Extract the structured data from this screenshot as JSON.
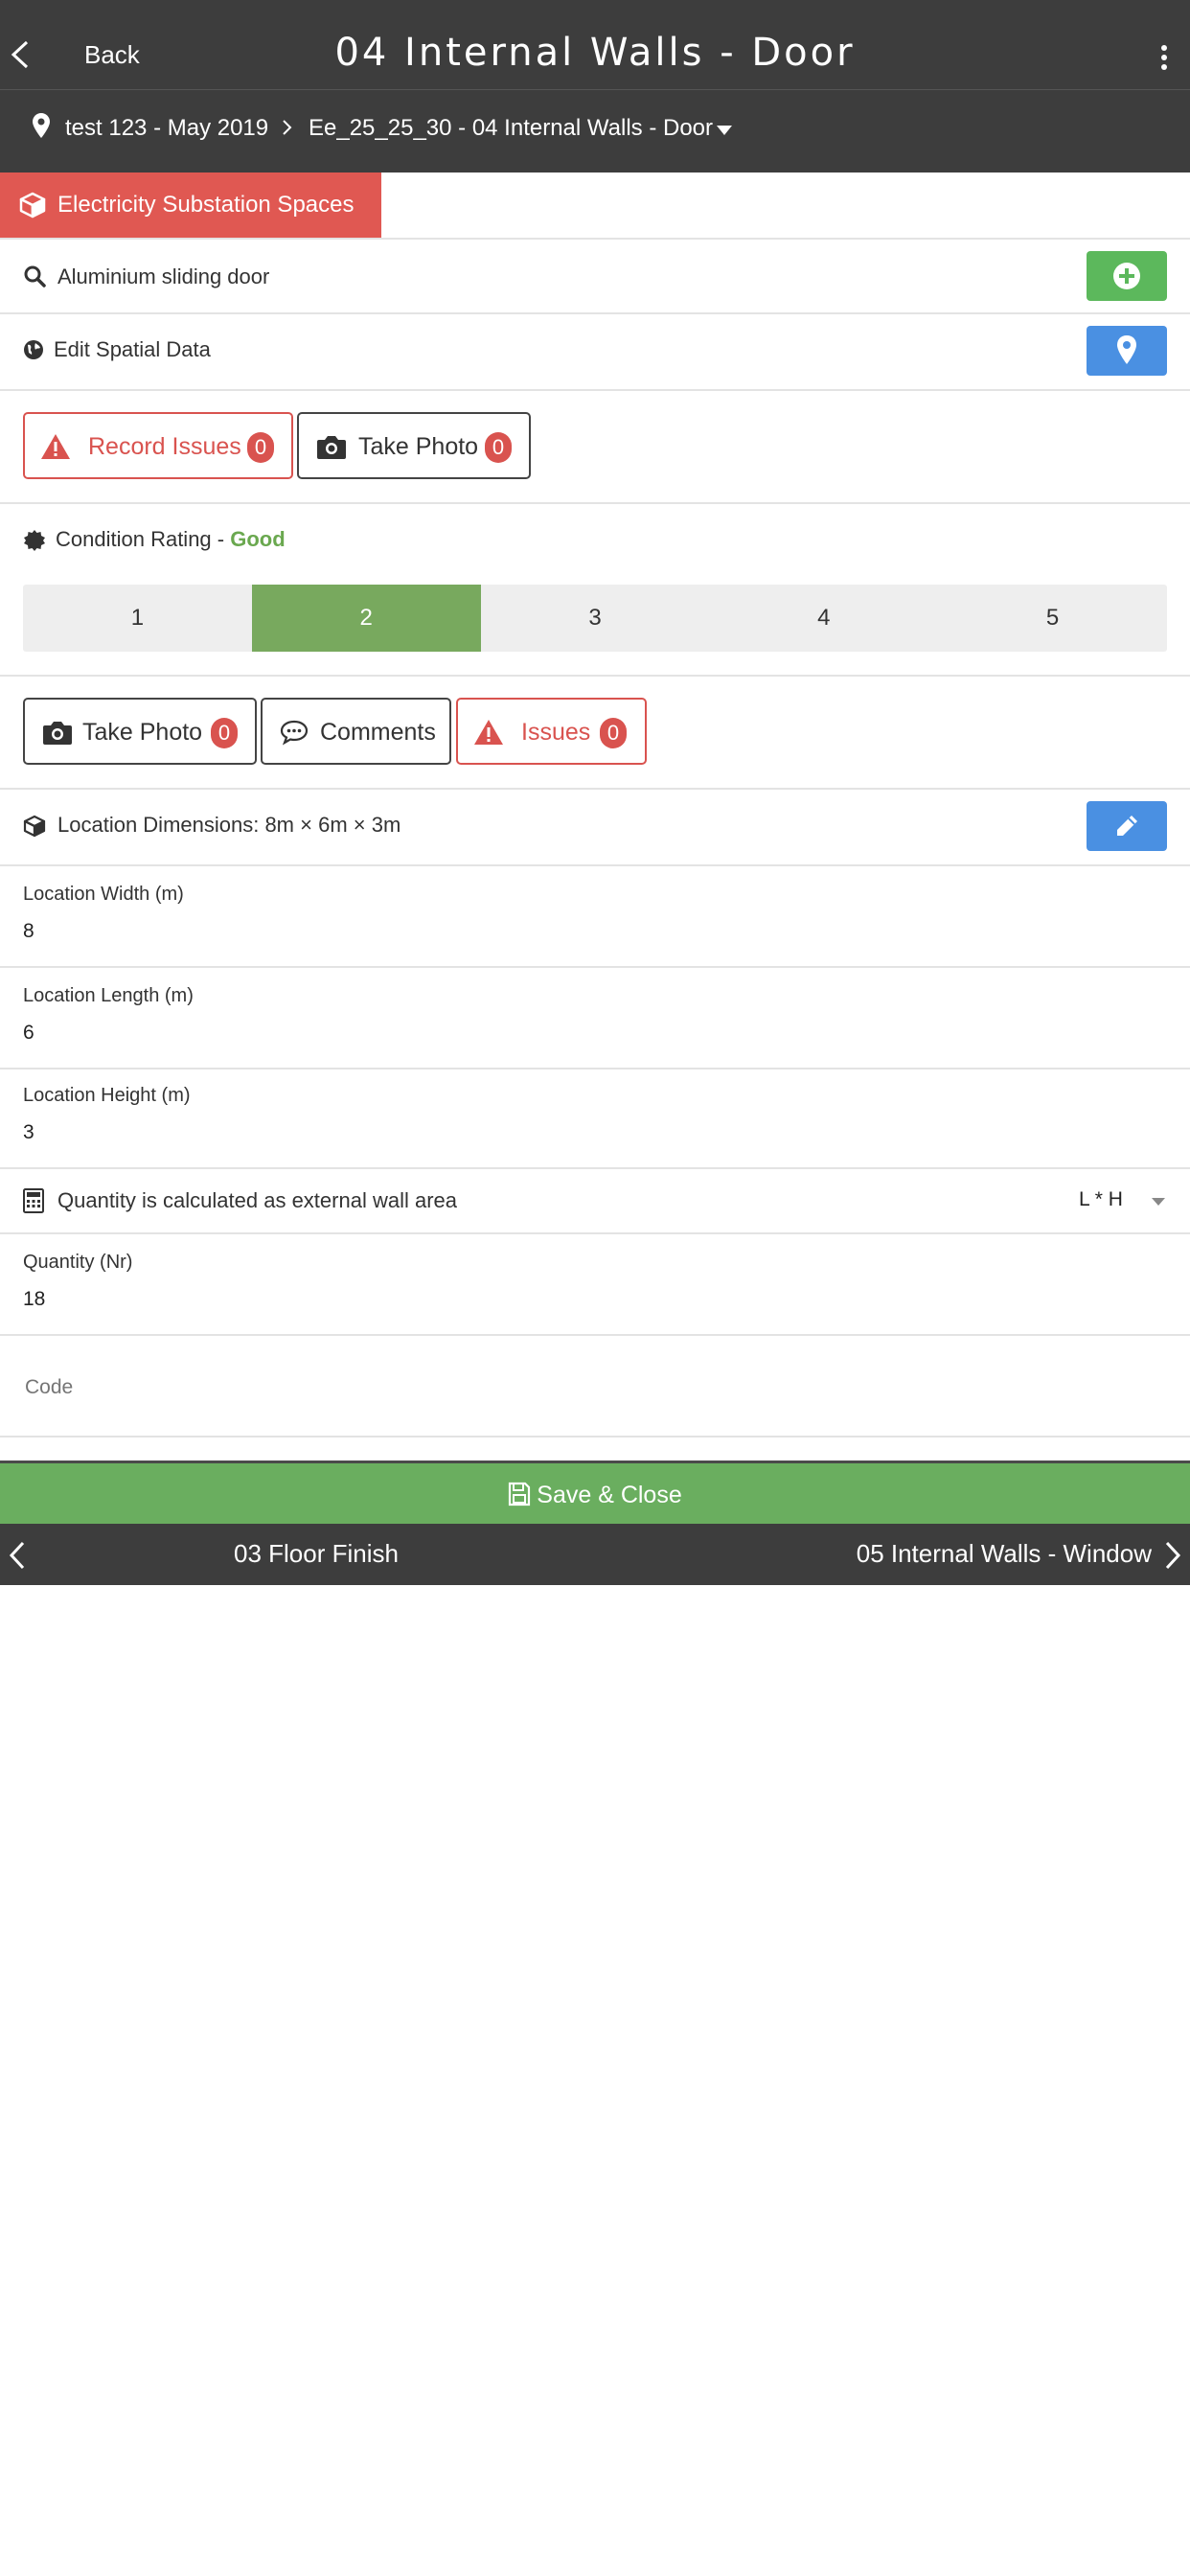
{
  "header": {
    "back_label": "Back",
    "title": "04 Internal Walls - Door"
  },
  "breadcrumb": {
    "project": "test 123 - May 2019",
    "element": "Ee_25_25_30 - 04 Internal Walls - Door"
  },
  "space_tag": "Electricity Substation Spaces",
  "product_search": {
    "value": "Aluminium sliding door"
  },
  "spatial": {
    "label": "Edit Spatial Data"
  },
  "actions_top": {
    "record_issues_label": "Record Issues",
    "record_issues_count": "0",
    "take_photo_label": "Take Photo",
    "take_photo_count": "0"
  },
  "condition": {
    "prefix": "Condition Rating - ",
    "value": "Good",
    "options": [
      "1",
      "2",
      "3",
      "4",
      "5"
    ],
    "selected": 2
  },
  "actions_rating": {
    "take_photo_label": "Take Photo",
    "take_photo_count": "0",
    "comments_label": "Comments",
    "issues_label": "Issues",
    "issues_count": "0"
  },
  "dimensions": {
    "label": "Location Dimensions: 8m × 6m × 3m",
    "width_label": "Location Width (m)",
    "width_value": "8",
    "length_label": "Location Length (m)",
    "length_value": "6",
    "height_label": "Location Height (m)",
    "height_value": "3"
  },
  "quantity": {
    "calc_label": "Quantity is calculated as external wall area",
    "formula": "L * H",
    "label": "Quantity (Nr)",
    "value": "18"
  },
  "code": {
    "placeholder": "Code"
  },
  "save_label": "Save & Close",
  "nav": {
    "prev": "03 Floor Finish",
    "next": "05 Internal Walls - Window"
  },
  "colors": {
    "header_bg": "#3d3d3d",
    "accent_red": "#e05852",
    "accent_green": "#5cb85c",
    "accent_blue": "#4a90e2",
    "rating_active": "#78a95e"
  }
}
